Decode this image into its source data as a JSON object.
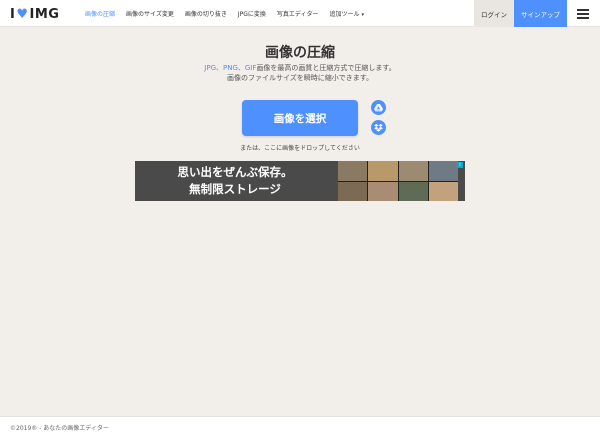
{
  "brand": {
    "logo_left": "I",
    "logo_heart": "♥",
    "logo_right": "IMG"
  },
  "nav": {
    "items": [
      {
        "label": "画像の圧縮",
        "active": true
      },
      {
        "label": "画像のサイズ変更",
        "active": false
      },
      {
        "label": "画像の切り抜き",
        "active": false
      },
      {
        "label": "JPGに変換",
        "active": false
      },
      {
        "label": "写真エディター",
        "active": false
      },
      {
        "label": "追加ツール",
        "active": false,
        "caret": "▾"
      }
    ],
    "login_label": "ログイン",
    "signup_label": "サインアップ"
  },
  "main": {
    "title": "画像の圧縮",
    "subtitle_formats": "JPG、PNG、GIF",
    "subtitle_line1_rest": "画像を最高の画質と圧縮方式で圧縮します。",
    "subtitle_line2": "画像のファイルサイズを瞬時に縮小できます。",
    "select_button": "画像を選択",
    "drop_text": "または、ここに画像をドロップしてください"
  },
  "ad": {
    "line1": "思い出をぜんぶ保存。",
    "line2": "無制限ストレージ",
    "photo_colors": [
      "#8a7a62",
      "#b89a6a",
      "#9c8b70",
      "#6f7a85",
      "#7d6a55",
      "#a88c73",
      "#5f6b55",
      "#c2a27c"
    ]
  },
  "footer": {
    "text": "©2019® - あなたの画像エディター"
  },
  "colors": {
    "accent": "#4d90fe",
    "background": "#f2efea"
  }
}
